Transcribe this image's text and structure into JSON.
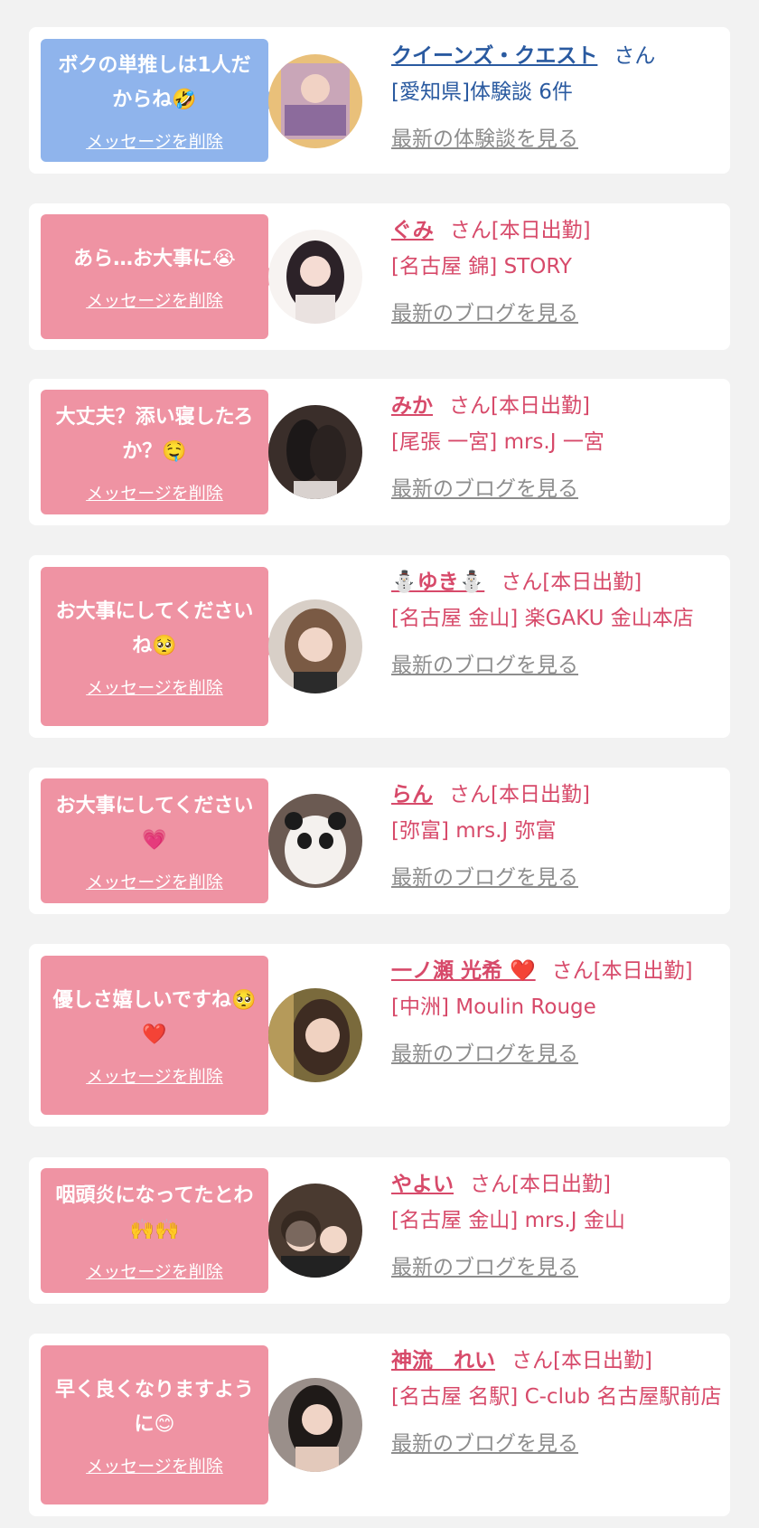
{
  "cards": [
    {
      "message": "ボクの単推しは1人だからね🤣",
      "delete_label": "メッセージを削除",
      "name": "クイーンズ・クエスト",
      "suffix": "さん",
      "shop": "[愛知県]体験談 6件",
      "link": "最新の体験談を見る",
      "theme": "blue",
      "avatar_icon": "avatar-photo"
    },
    {
      "message": "あら…お大事に😭",
      "delete_label": "メッセージを削除",
      "name": "ぐみ",
      "suffix": "さん[本日出勤]",
      "shop": "[名古屋 錦] STORY",
      "link": "最新のブログを見る",
      "theme": "pink",
      "avatar_icon": "avatar-photo"
    },
    {
      "message": "大丈夫？添い寝したろか？🤤",
      "delete_label": "メッセージを削除",
      "name": "みか",
      "suffix": "さん[本日出勤]",
      "shop": "[尾張 一宮] mrs.J 一宮",
      "link": "最新のブログを見る",
      "theme": "pink",
      "avatar_icon": "avatar-photo"
    },
    {
      "message": "お大事にしてくださいね🥺",
      "delete_label": "メッセージを削除",
      "name": "⛄ゆき⛄",
      "suffix": "さん[本日出勤]",
      "shop": "[名古屋 金山] 楽GAKU 金山本店",
      "link": "最新のブログを見る",
      "theme": "pink",
      "avatar_icon": "avatar-photo"
    },
    {
      "message": "お大事にしてください 💗",
      "delete_label": "メッセージを削除",
      "name": "らん",
      "suffix": "さん[本日出勤]",
      "shop": "[弥富] mrs.J 弥富",
      "link": "最新のブログを見る",
      "theme": "pink",
      "avatar_icon": "avatar-photo"
    },
    {
      "message": "優しさ嬉しいですね🥺❤️",
      "delete_label": "メッセージを削除",
      "name": "一ノ瀬 光希 ❤️",
      "suffix": "さん[本日出勤]",
      "shop": "[中洲] Moulin Rouge",
      "link": "最新のブログを見る",
      "theme": "pink",
      "avatar_icon": "avatar-photo"
    },
    {
      "message": "咽頭炎になってたとわ🙌🙌",
      "delete_label": "メッセージを削除",
      "name": "やよい",
      "suffix": "さん[本日出勤]",
      "shop": "[名古屋 金山] mrs.J 金山",
      "link": "最新のブログを見る",
      "theme": "pink",
      "avatar_icon": "avatar-photo"
    },
    {
      "message": "早く良くなりますように😊",
      "delete_label": "メッセージを削除",
      "name": "神流　れい",
      "suffix": "さん[本日出勤]",
      "shop": "[名古屋 名駅] C-club 名古屋駅前店",
      "link": "最新のブログを見る",
      "theme": "pink",
      "avatar_icon": "avatar-photo"
    }
  ]
}
